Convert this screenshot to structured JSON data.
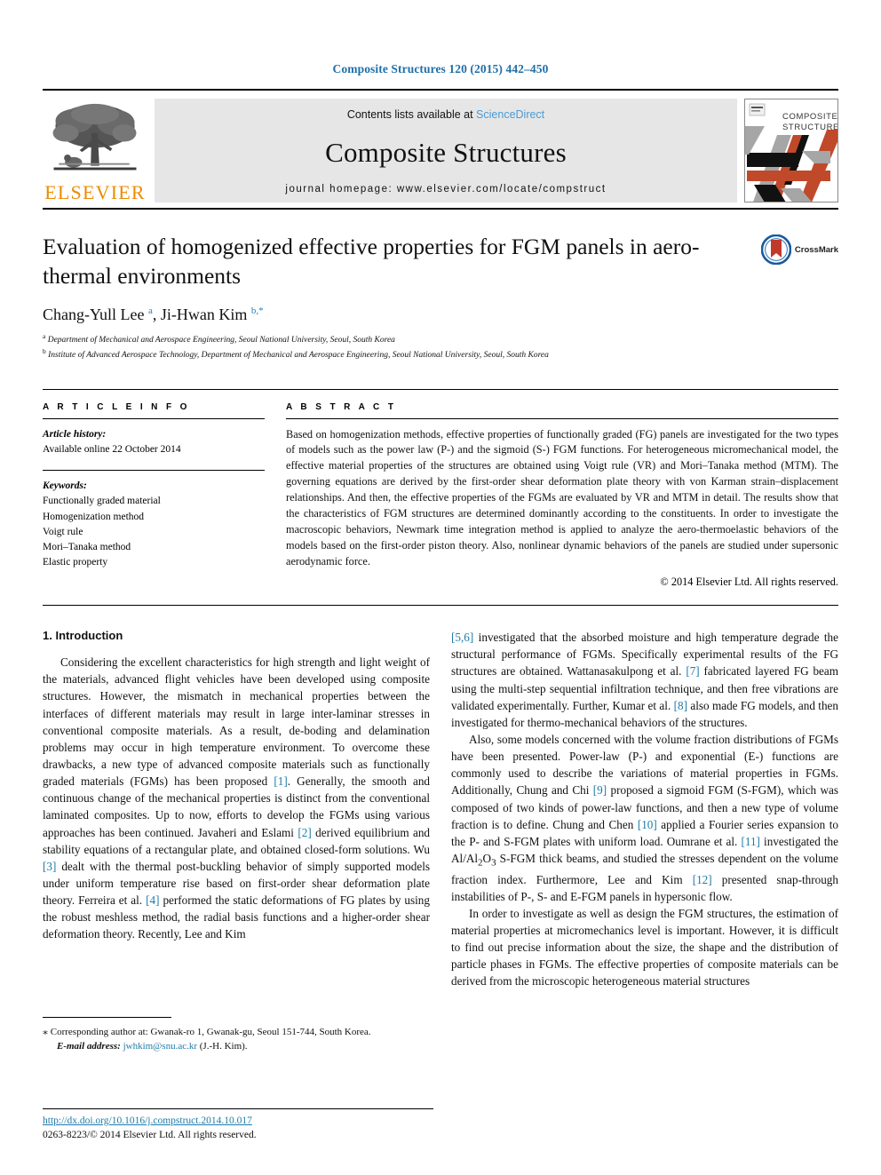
{
  "running_head": "Composite Structures 120 (2015) 442–450",
  "masthead": {
    "publisher_name": "ELSEVIER",
    "contents_prefix": "Contents lists available at ",
    "contents_link": "ScienceDirect",
    "journal_title": "Composite Structures",
    "homepage_line": "journal homepage: www.elsevier.com/locate/compstruct",
    "cover_title_line1": "COMPOSITE",
    "cover_title_line2": "STRUCTURES"
  },
  "article": {
    "title": "Evaluation of homogenized effective properties for FGM panels in aero-thermal environments",
    "authors_html": "Chang-Yull Lee <sup>a</sup>, Ji-Hwan Kim <sup>b,*</sup>",
    "affiliation_a": "Department of Mechanical and Aerospace Engineering, Seoul National University, Seoul, South Korea",
    "affiliation_b": "Institute of Advanced Aerospace Technology, Department of Mechanical and Aerospace Engineering, Seoul National University, Seoul, South Korea",
    "crossmark_label": "CrossMark"
  },
  "info": {
    "heading": "A R T I C L E    I N F O",
    "history_label": "Article history:",
    "history_value": "Available online 22 October 2014",
    "keywords_label": "Keywords:",
    "keywords": [
      "Functionally graded material",
      "Homogenization method",
      "Voigt rule",
      "Mori–Tanaka method",
      "Elastic property"
    ]
  },
  "abstract": {
    "heading": "A B S T R A C T",
    "text": "Based on homogenization methods, effective properties of functionally graded (FG) panels are investigated for the two types of models such as the power law (P-) and the sigmoid (S-) FGM functions. For heterogeneous micromechanical model, the effective material properties of the structures are obtained using Voigt rule (VR) and Mori–Tanaka method (MTM). The governing equations are derived by the first-order shear deformation plate theory with von Karman strain–displacement relationships. And then, the effective properties of the FGMs are evaluated by VR and MTM in detail. The results show that the characteristics of FGM structures are determined dominantly according to the constituents. In order to investigate the macroscopic behaviors, Newmark time integration method is applied to analyze the aero-thermoelastic behaviors of the models based on the first-order piston theory. Also, nonlinear dynamic behaviors of the panels are studied under supersonic aerodynamic force.",
    "copyright": "© 2014 Elsevier Ltd. All rights reserved."
  },
  "body": {
    "section_title": "1. Introduction",
    "left_para_1_html": "Considering the excellent characteristics for high strength and light weight of the materials, advanced flight vehicles have been developed using composite structures. However, the mismatch in mechanical properties between the interfaces of different materials may result in large inter-laminar stresses in conventional composite materials. As a result, de-boding and delamination problems may occur in high temperature environment. To overcome these drawbacks, a new type of advanced composite materials such as functionally graded materials (FGMs) has been proposed <span class=\"ref\">[1]</span>. Generally, the smooth and continuous change of the mechanical properties is distinct from the conventional laminated composites. Up to now, efforts to develop the FGMs using various approaches has been continued. Javaheri and Eslami <span class=\"ref\">[2]</span> derived equilibrium and stability equations of a rectangular plate, and obtained closed-form solutions. Wu <span class=\"ref\">[3]</span> dealt with the thermal post-buckling behavior of simply supported models under uniform temperature rise based on first-order shear deformation plate theory. Ferreira et al. <span class=\"ref\">[4]</span> performed the static deformations of FG plates by using the robust meshless method, the radial basis functions and a higher-order shear deformation theory. Recently, Lee and Kim",
    "right_para_1_html": "<span class=\"ref\">[5,6]</span> investigated that the absorbed moisture and high temperature degrade the structural performance of FGMs. Specifically experimental results of the FG structures are obtained. Wattanasakulpong et al. <span class=\"ref\">[7]</span> fabricated layered FG beam using the multi-step sequential infiltration technique, and then free vibrations are validated experimentally. Further, Kumar et al. <span class=\"ref\">[8]</span> also made FG models, and then investigated for thermo-mechanical behaviors of the structures.",
    "right_para_2_html": "Also, some models concerned with the volume fraction distributions of FGMs have been presented. Power-law (P-) and exponential (E-) functions are commonly used to describe the variations of material properties in FGMs. Additionally, Chung and Chi <span class=\"ref\">[9]</span> proposed a sigmoid FGM (S-FGM), which was composed of two kinds of power-law functions, and then a new type of volume fraction is to define. Chung and Chen <span class=\"ref\">[10]</span> applied a Fourier series expansion to the P- and S-FGM plates with uniform load. Oumrane et al. <span class=\"ref\">[11]</span> investigated the Al/Al<sub>2</sub>O<sub>3</sub> S-FGM thick beams, and studied the stresses dependent on the volume fraction index. Furthermore, Lee and Kim <span class=\"ref\">[12]</span> presented snap-through instabilities of P-, S- and E-FGM panels in hypersonic flow.",
    "right_para_3_html": "In order to investigate as well as design the FGM structures, the estimation of material properties at micromechanics level is important. However, it is difficult to find out precise information about the size, the shape and the distribution of particle phases in FGMs. The effective properties of composite materials can be derived from the microscopic heterogeneous material structures"
  },
  "footnote": {
    "corresponding_html": "<span style=\"font-size:12px\">⁎</span> Corresponding author at: Gwanak-ro 1, Gwanak-gu, Seoul 151-744, South Korea.",
    "email_label": "E-mail address:",
    "email_value": "jwhkim@snu.ac.kr",
    "email_suffix": "(J.-H. Kim)."
  },
  "doi": {
    "url": "http://dx.doi.org/10.1016/j.compstruct.2014.10.017",
    "issn_line": "0263-8223/© 2014 Elsevier Ltd. All rights reserved."
  },
  "colors": {
    "link": "#1f7ba8",
    "running_head": "#1f6fa8",
    "elsevier_orange": "#ED8B00",
    "banner_bg": "#e6e6e6",
    "cover_orange": "#C0492A",
    "cover_gray": "#A6A6A6"
  }
}
